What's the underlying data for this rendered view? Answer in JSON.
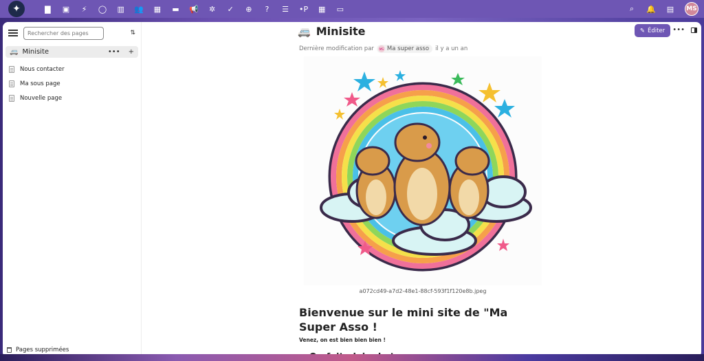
{
  "topbar": {
    "logo_glyph": "✦",
    "apps": [
      {
        "icon": "folder-icon",
        "glyph": "▇"
      },
      {
        "icon": "photos-icon",
        "glyph": "▣"
      },
      {
        "icon": "activity-icon",
        "glyph": "⚡"
      },
      {
        "icon": "search-circle-icon",
        "glyph": "◯"
      },
      {
        "icon": "deck-icon",
        "glyph": "▥"
      },
      {
        "icon": "contacts-icon",
        "glyph": "👥"
      },
      {
        "icon": "calendar-icon",
        "glyph": "▦"
      },
      {
        "icon": "inbox-icon",
        "glyph": "▬"
      },
      {
        "icon": "announcement-icon",
        "glyph": "📢"
      },
      {
        "icon": "circles-icon",
        "glyph": "✲"
      },
      {
        "icon": "tasks-icon",
        "glyph": "✓"
      },
      {
        "icon": "globe-icon",
        "glyph": "⊕"
      },
      {
        "icon": "help-icon",
        "glyph": "?"
      },
      {
        "icon": "list-icon",
        "glyph": "☰"
      },
      {
        "icon": "collectives-icon",
        "glyph": "•P"
      },
      {
        "icon": "table-icon",
        "glyph": "▦"
      },
      {
        "icon": "screen-icon",
        "glyph": "▭"
      }
    ],
    "right": [
      {
        "icon": "search-icon",
        "glyph": "⌕"
      },
      {
        "icon": "notification-icon",
        "glyph": "🔔"
      },
      {
        "icon": "contacts-book-icon",
        "glyph": "▤"
      }
    ],
    "avatar": "MS"
  },
  "sidebar": {
    "search_placeholder": "Rechercher des pages",
    "root": {
      "emoji": "🚐",
      "label": "Minisite",
      "more": "•••",
      "add": "+"
    },
    "items": [
      "Nous contacter",
      "Ma sous page",
      "Nouvelle page"
    ],
    "trash_label": "Pages supprimées"
  },
  "page": {
    "emoji": "🚐",
    "title": "Minisite",
    "meta_prefix": "Dernière modification par",
    "meta_user": "Ma super asso",
    "meta_user_initials": "MS",
    "meta_time": "il y a un an",
    "edit_label": "Éditer",
    "image_caption": "a072cd49-a7d2-48e1-88cf-593f1f120e8b.jpeg",
    "heading": "Bienvenue sur le mini site de \"Ma Super Asso !",
    "subtext": "Venez, on est bien bien bien !",
    "cut_heading": "On fait plein de trucs"
  },
  "colors": {
    "accent": "#6e56b4"
  }
}
